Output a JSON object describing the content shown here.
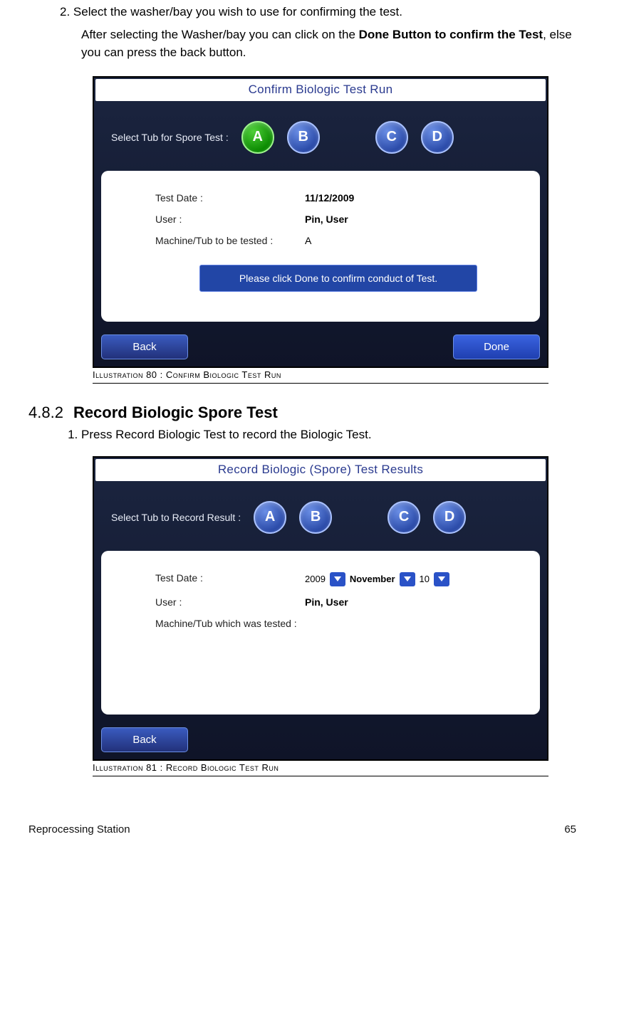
{
  "intro": {
    "step2_prefix": "2. ",
    "step2_text": "Select the washer/bay you wish to use for confirming the test.",
    "after_text_plain": "After selecting the Washer/bay you can click on the ",
    "after_text_bold": "Done Button to confirm the Test",
    "after_text_tail": ", else you can press the back button."
  },
  "illus80": {
    "caption": "Illustration 80 : Confirm Biologic Test Run",
    "title": "Confirm Biologic Test Run",
    "select_label": "Select Tub for Spore Test :",
    "tubs": [
      "A",
      "B",
      "C",
      "D"
    ],
    "selected": "A",
    "rows": {
      "test_date_label": "Test Date :",
      "test_date_value": "11/12/2009",
      "user_label": "User :",
      "user_value": "Pin, User",
      "tub_label": "Machine/Tub to be tested :",
      "tub_value": "A"
    },
    "confirm_msg": "Please click Done to confirm conduct of Test.",
    "back": "Back",
    "done": "Done"
  },
  "section": {
    "number": "4.8.2",
    "title": "Record Biologic Spore Test",
    "step1": "Press Record Biologic Test to record the Biologic Test."
  },
  "illus81": {
    "caption": "Illustration 81 :  Record Biologic Test Run",
    "title": "Record Biologic (Spore) Test Results",
    "select_label": "Select Tub to Record Result :",
    "tubs": [
      "A",
      "B",
      "C",
      "D"
    ],
    "rows": {
      "test_date_label": "Test Date :",
      "year": "2009",
      "month": "November",
      "day": "10",
      "user_label": "User :",
      "user_value": "Pin, User",
      "tub_label": "Machine/Tub which was tested :"
    },
    "back": "Back"
  },
  "footer": {
    "left": "Reprocessing Station",
    "right": "65"
  }
}
